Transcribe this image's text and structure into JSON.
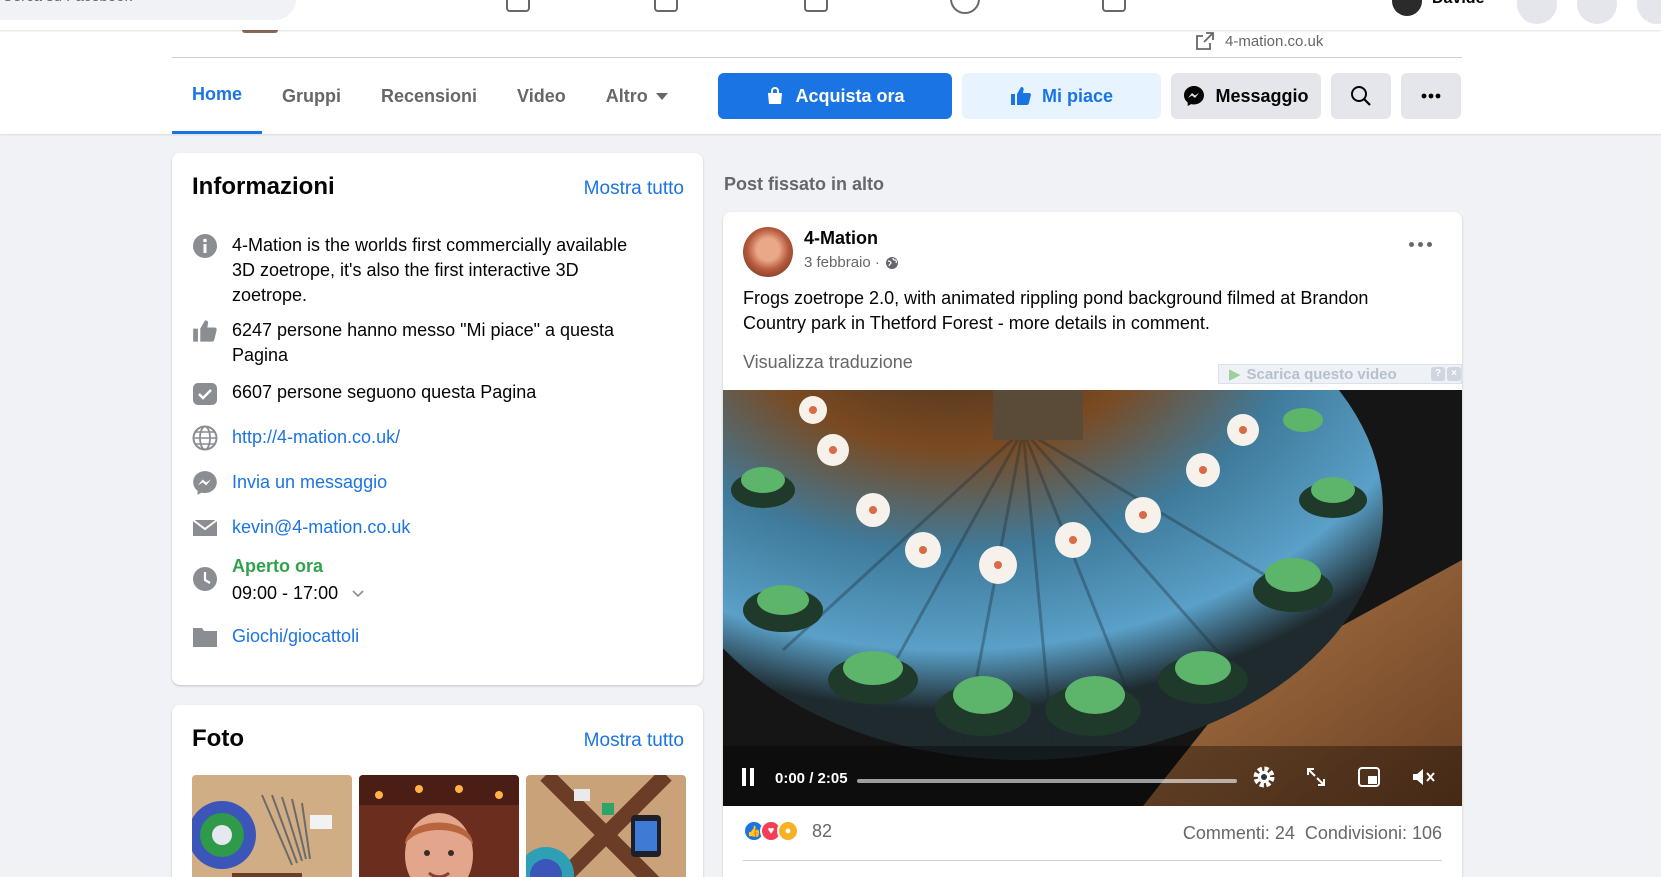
{
  "topbar": {
    "search_placeholder": "Cerca su Facebook",
    "user_name": "Davide"
  },
  "header": {
    "website": "4-mation.co.uk",
    "tabs": [
      {
        "label": "Home"
      },
      {
        "label": "Gruppi"
      },
      {
        "label": "Recensioni"
      },
      {
        "label": "Video"
      },
      {
        "label": "Altro"
      }
    ],
    "buttons": {
      "buy": "Acquista ora",
      "like": "Mi piace",
      "message": "Messaggio"
    }
  },
  "info": {
    "title": "Informazioni",
    "show_all": "Mostra tutto",
    "description": "4-Mation is the worlds first commercially available 3D zoetrope, it's also the first interactive 3D zoetrope.",
    "likes": "6247 persone hanno messo \"Mi piace\" a questa Pagina",
    "followers": "6607 persone seguono questa Pagina",
    "website": "http://4-mation.co.uk/",
    "send_message": "Invia un messaggio",
    "email": "kevin@4-mation.co.uk",
    "open_status": "Aperto ora",
    "hours": "09:00 - 17:00",
    "category": "Giochi/giocattoli"
  },
  "photos": {
    "title": "Foto",
    "show_all": "Mostra tutto"
  },
  "feed": {
    "pinned_label": "Post fissato in alto",
    "post": {
      "author": "4-Mation",
      "date": "3 febbraio ·",
      "text": "Frogs zoetrope 2.0, with animated rippling pond background filmed at Brandon Country park in Thetford Forest - more details in comment.",
      "translate": "Visualizza traduzione",
      "download_badge": "Scarica questo video",
      "video_time": "0:00 / 2:05",
      "reactions_count": "82",
      "comments": "Commenti: 24",
      "shares": "Condivisioni: 106"
    }
  },
  "colors": {
    "accent": "#1b74e4",
    "open_green": "#31a24c",
    "background": "#f0f2f5"
  }
}
